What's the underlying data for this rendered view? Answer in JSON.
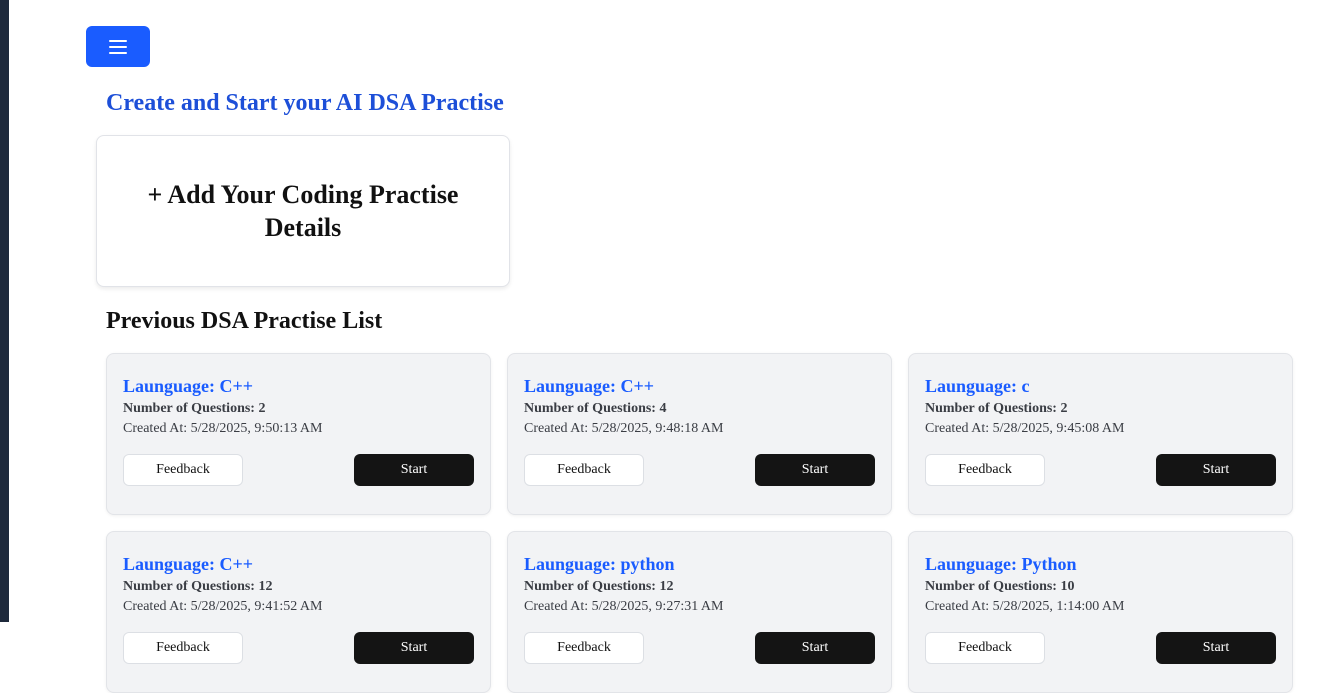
{
  "header": {
    "title": "Create and Start your AI DSA Practise",
    "menu_icon": "hamburger-menu-icon",
    "accent_color": "#1a5cff"
  },
  "add_card": {
    "label": "+ Add Your Coding Practise Details"
  },
  "previous_list": {
    "title": "Previous DSA Practise List",
    "cards": [
      {
        "language": "Launguage: C++",
        "questions": "Number of Questions: 2",
        "created": "Created At: 5/28/2025, 9:50:13 AM",
        "feedback_label": "Feedback",
        "start_label": "Start"
      },
      {
        "language": "Launguage: C++",
        "questions": "Number of Questions: 4",
        "created": "Created At: 5/28/2025, 9:48:18 AM",
        "feedback_label": "Feedback",
        "start_label": "Start"
      },
      {
        "language": "Launguage: c",
        "questions": "Number of Questions: 2",
        "created": "Created At: 5/28/2025, 9:45:08 AM",
        "feedback_label": "Feedback",
        "start_label": "Start"
      },
      {
        "language": "Launguage: C++",
        "questions": "Number of Questions: 12",
        "created": "Created At: 5/28/2025, 9:41:52 AM",
        "feedback_label": "Feedback",
        "start_label": "Start"
      },
      {
        "language": "Launguage: python",
        "questions": "Number of Questions: 12",
        "created": "Created At: 5/28/2025, 9:27:31 AM",
        "feedback_label": "Feedback",
        "start_label": "Start"
      },
      {
        "language": "Launguage: Python",
        "questions": "Number of Questions: 10",
        "created": "Created At: 5/28/2025, 1:14:00 AM",
        "feedback_label": "Feedback",
        "start_label": "Start"
      }
    ]
  }
}
